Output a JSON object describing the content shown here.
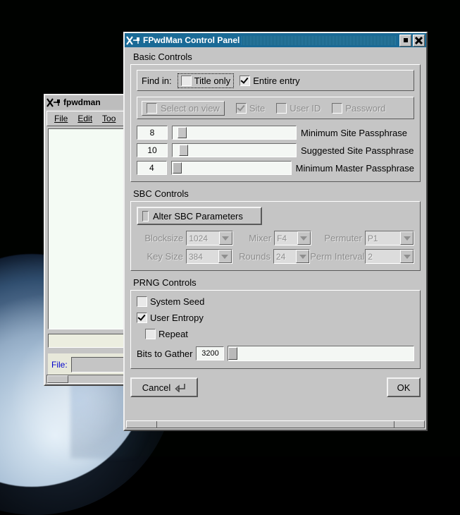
{
  "desktop": {
    "background_name": "earth-from-space-wallpaper"
  },
  "bg_window": {
    "title": "fpwdman",
    "icon": "x-window-icon",
    "menu": [
      {
        "label": "File",
        "mnemonic": "F"
      },
      {
        "label": "Edit",
        "mnemonic": "E"
      },
      {
        "label": "Too",
        "mnemonic": "T"
      }
    ],
    "file_label": "File:",
    "file_value": ""
  },
  "dialog": {
    "title": "FPwdMan Control Panel",
    "icon": "x-window-icon",
    "minimize_label": "■",
    "close_label": "✕",
    "basic": {
      "section_label": "Basic Controls",
      "find_in_label": "Find in:",
      "find_options": [
        {
          "label": "Title only",
          "checked": false,
          "focused": true
        },
        {
          "label": "Entire entry",
          "checked": true,
          "focused": false
        }
      ],
      "select_on_view": {
        "label": "Select on view",
        "checked": false,
        "enabled": false
      },
      "select_fields": [
        {
          "label": "Site",
          "checked": true,
          "enabled": false
        },
        {
          "label": "User ID",
          "checked": false,
          "enabled": false
        },
        {
          "label": "Password",
          "checked": false,
          "enabled": false
        }
      ],
      "sliders": [
        {
          "value": "8",
          "label": "Minimum Site Passphrase",
          "thumb_pct": 4
        },
        {
          "value": "10",
          "label": "Suggested Site Passphrase",
          "thumb_pct": 5
        },
        {
          "value": "4",
          "label": "Minimum Master Passphrase",
          "thumb_pct": 1
        }
      ]
    },
    "sbc": {
      "section_label": "SBC Controls",
      "alter_button": {
        "label": "Alter SBC Parameters",
        "checked": false
      },
      "params": [
        {
          "label": "Blocksize",
          "value": "1024",
          "enabled": false
        },
        {
          "label": "Mixer",
          "value": "F4",
          "enabled": false
        },
        {
          "label": "Permuter",
          "value": "P1",
          "enabled": false
        },
        {
          "label": "Key Size",
          "value": "384",
          "enabled": false
        },
        {
          "label": "Rounds",
          "value": "24",
          "enabled": false
        },
        {
          "label": "Perm Interval",
          "value": "2",
          "enabled": false
        }
      ]
    },
    "prng": {
      "section_label": "PRNG Controls",
      "checks": [
        {
          "label": "System Seed",
          "checked": false,
          "indent": 0
        },
        {
          "label": "User Entropy",
          "checked": true,
          "indent": 0
        },
        {
          "label": "Repeat",
          "checked": false,
          "indent": 1
        }
      ],
      "bits_label": "Bits to Gather",
      "bits_value": "3200",
      "bits_thumb_pct": 1
    },
    "buttons": {
      "cancel": "Cancel",
      "cancel_glyph": "return-arrow-icon",
      "ok": "OK"
    }
  },
  "colors": {
    "titlebar_active": "#1a6a96",
    "face": "#c5c5c5",
    "field": "#f4f7f4",
    "disabled_text": "#8d8d8d",
    "file_label": "#0000cc"
  }
}
